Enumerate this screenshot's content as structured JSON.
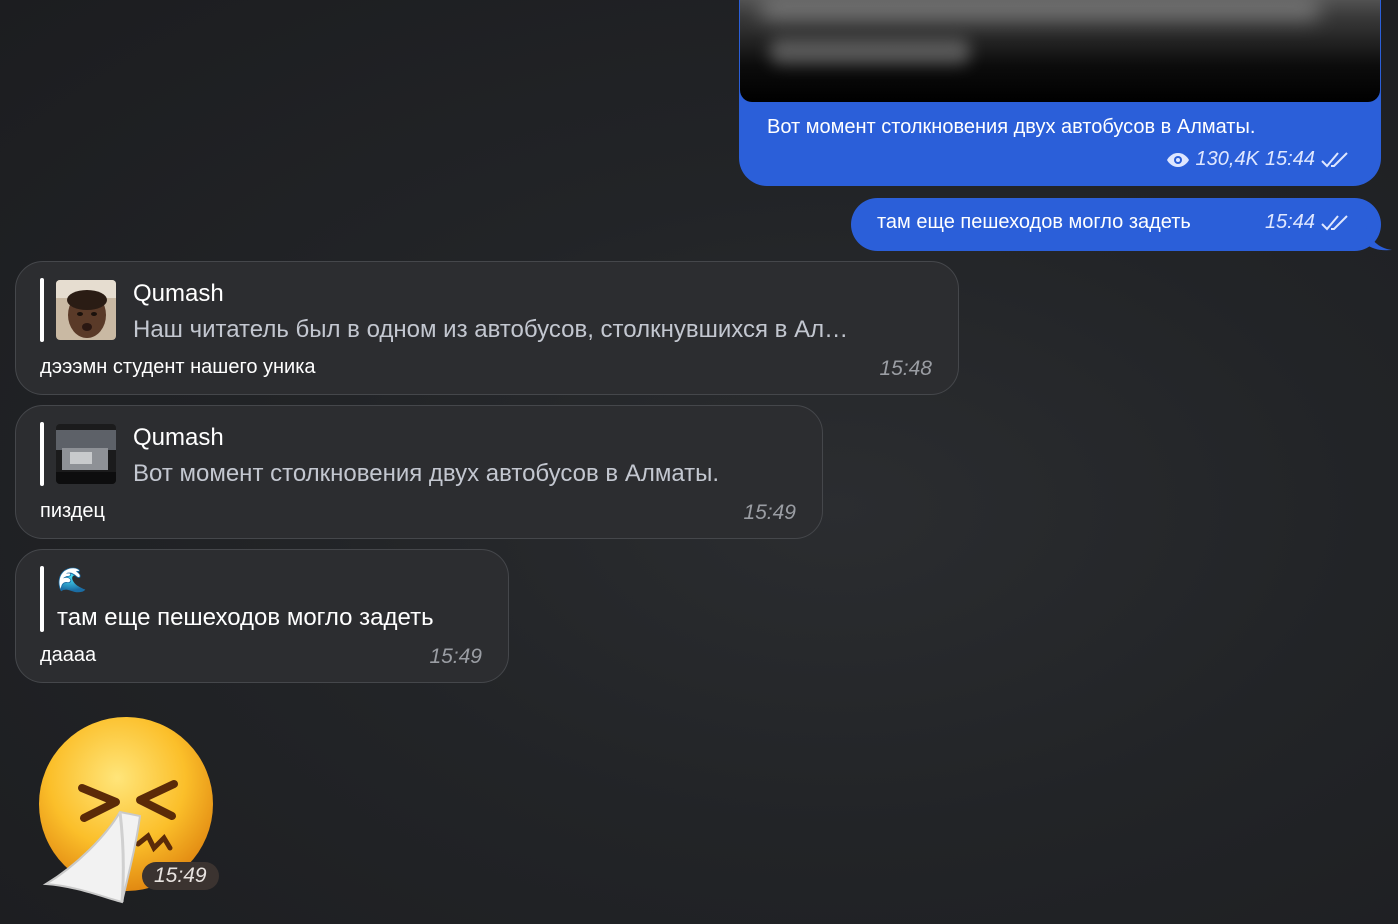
{
  "outgoing": {
    "media_post": {
      "caption": "Вот момент столкновения двух автобусов в Алматы.",
      "views": "130,4K",
      "time": "15:44"
    },
    "text_message": {
      "text": "там еще пешеходов могло задеть",
      "time": "15:44"
    }
  },
  "incoming": [
    {
      "quote_author": "Qumash",
      "quote_text": "Наш читатель был в одном из автобусов, столкнувшихся в Ал…",
      "text": "дэээмн студент нашего уника",
      "time": "15:48"
    },
    {
      "quote_author": "Qumash",
      "quote_text": "Вот момент столкновения двух автобусов в Алматы.",
      "text": "пиздец",
      "time": "15:49"
    },
    {
      "quote_emoji": "🌊",
      "quote_text": "там еще пешеходов могло задеть",
      "text": "даааа",
      "time": "15:49"
    }
  ],
  "sticker": {
    "icon": "sneezing-face-sticker",
    "time": "15:49"
  },
  "colors": {
    "outgoing_bubble": "#2b5fd9",
    "incoming_bubble": "#2c2d30",
    "background": "#222427"
  }
}
